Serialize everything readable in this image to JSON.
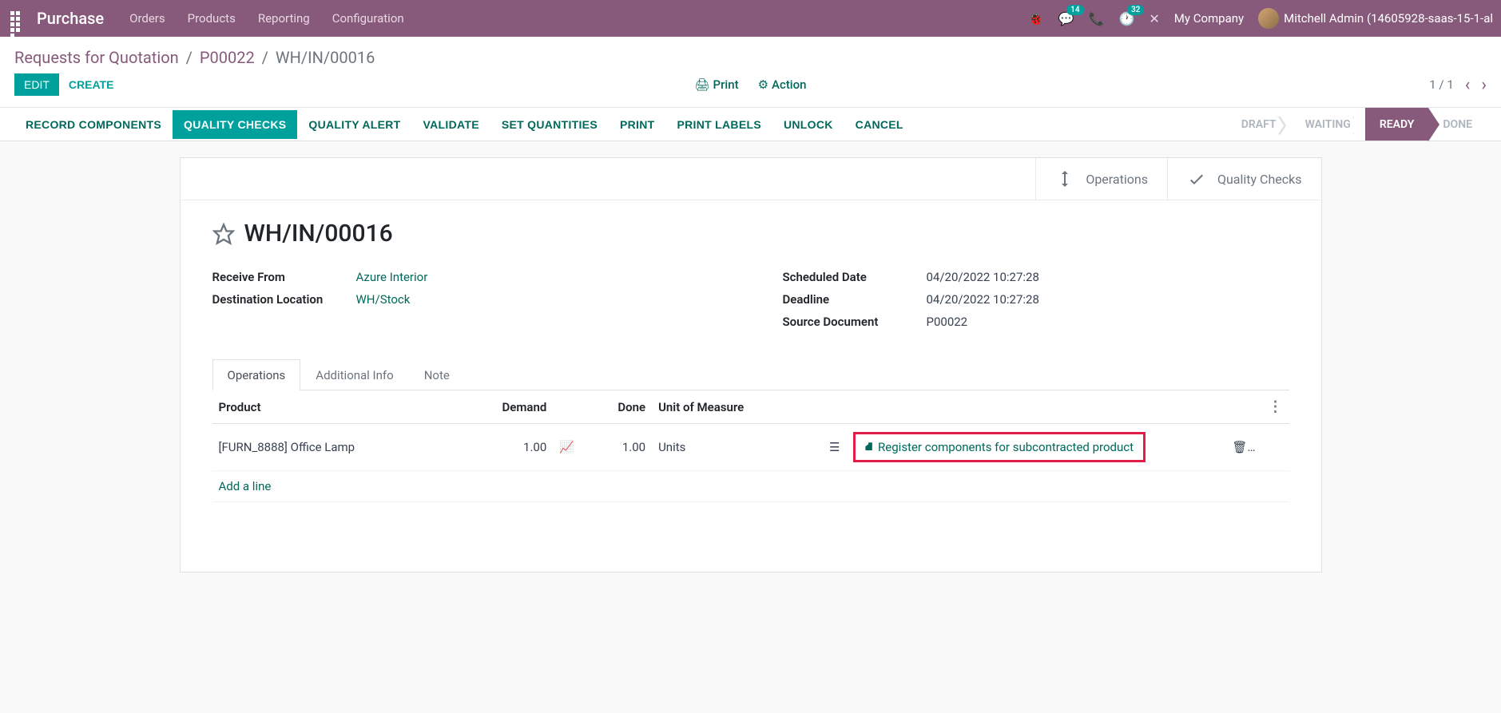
{
  "topnav": {
    "brand": "Purchase",
    "menu": [
      "Orders",
      "Products",
      "Reporting",
      "Configuration"
    ],
    "msg_badge": "14",
    "activity_badge": "32",
    "company": "My Company",
    "user": "Mitchell Admin (14605928-saas-15-1-al"
  },
  "breadcrumb": {
    "root": "Requests for Quotation",
    "parent": "P00022",
    "current": "WH/IN/00016"
  },
  "buttons": {
    "edit": "EDIT",
    "create": "CREATE",
    "print": "Print",
    "action": "Action"
  },
  "pager": {
    "text": "1 / 1"
  },
  "workflow": {
    "actions": [
      "RECORD COMPONENTS",
      "QUALITY CHECKS",
      "QUALITY ALERT",
      "VALIDATE",
      "SET QUANTITIES",
      "PRINT",
      "PRINT LABELS",
      "UNLOCK",
      "CANCEL"
    ],
    "active_action_idx": 1,
    "statuses": [
      "DRAFT",
      "WAITING",
      "READY",
      "DONE"
    ],
    "active_status_idx": 2
  },
  "stat_buttons": {
    "operations": "Operations",
    "quality": "Quality Checks"
  },
  "record": {
    "title": "WH/IN/00016",
    "fields_left": [
      {
        "label": "Receive From",
        "value": "Azure Interior",
        "link": true
      },
      {
        "label": "Destination Location",
        "value": "WH/Stock",
        "link": true
      }
    ],
    "fields_right": [
      {
        "label": "Scheduled Date",
        "value": "04/20/2022 10:27:28"
      },
      {
        "label": "Deadline",
        "value": "04/20/2022 10:27:28"
      },
      {
        "label": "Source Document",
        "value": "P00022"
      }
    ]
  },
  "tabs": [
    "Operations",
    "Additional Info",
    "Note"
  ],
  "table": {
    "headers": {
      "product": "Product",
      "demand": "Demand",
      "done": "Done",
      "uom": "Unit of Measure"
    },
    "row": {
      "product": "[FURN_8888] Office Lamp",
      "demand": "1.00",
      "done": "1.00",
      "uom": "Units",
      "register": "Register components for subcontracted product"
    },
    "addline": "Add a line"
  }
}
